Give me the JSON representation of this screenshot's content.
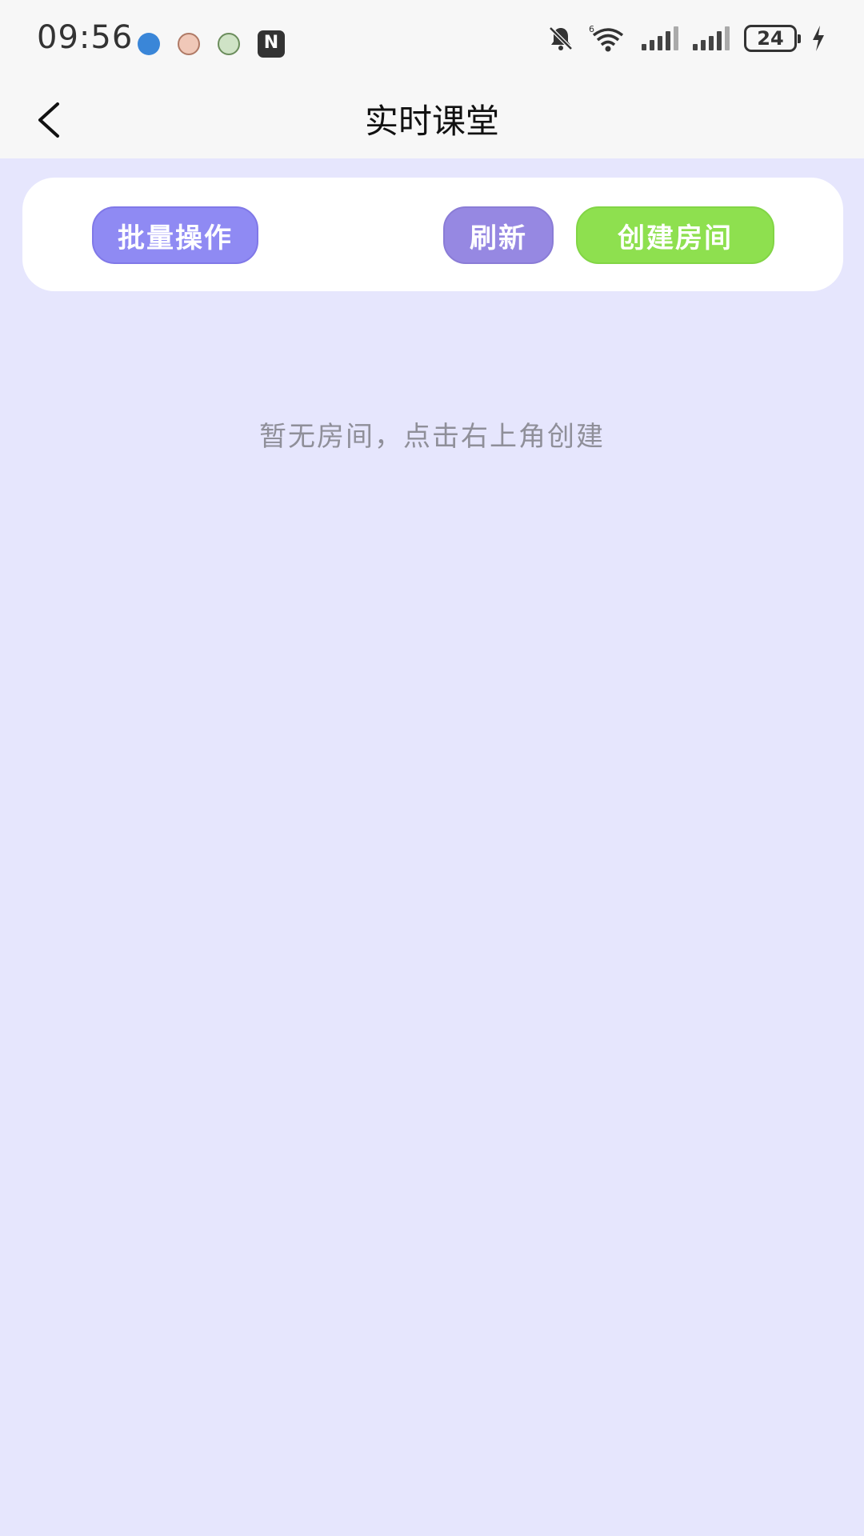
{
  "status_bar": {
    "time": "09:56",
    "battery": "24",
    "notification_icons": [
      "bluetooth-chat-icon",
      "pig-app-icon",
      "face-app-icon",
      "nfc-icon"
    ],
    "system_icons": [
      "mute-bell-icon",
      "wifi-icon",
      "signal-icon",
      "signal-icon",
      "battery-icon",
      "charging-icon"
    ]
  },
  "header": {
    "title": "实时课堂"
  },
  "toolbar": {
    "batch_label": "批量操作",
    "refresh_label": "刷新",
    "create_label": "创建房间"
  },
  "main": {
    "empty_message": "暂无房间，点击右上角创建"
  },
  "colors": {
    "background": "#e6e6fd",
    "batch_button": "#8f8af3",
    "refresh_button": "#9688e2",
    "create_button": "#8ee04f"
  }
}
